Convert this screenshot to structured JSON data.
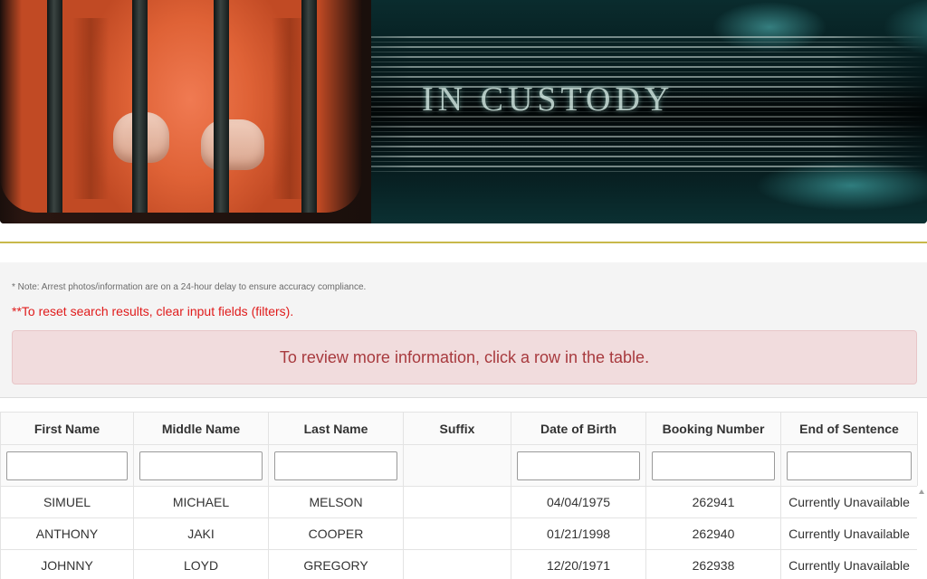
{
  "banner": {
    "title": "IN CUSTODY"
  },
  "notes": {
    "delay_note": "* Note: Arrest photos/information are on a 24-hour delay to ensure accuracy compliance.",
    "reset_note": "**To reset search results, clear input fields (filters).",
    "alert": "To review more information, click a row in the table."
  },
  "table": {
    "columns": [
      "First Name",
      "Middle Name",
      "Last Name",
      "Suffix",
      "Date of Birth",
      "Booking Number",
      "End of Sentence"
    ],
    "rows": [
      [
        "SIMUEL",
        "MICHAEL",
        "MELSON",
        "",
        "04/04/1975",
        "262941",
        "Currently Unavailable"
      ],
      [
        "ANTHONY",
        "JAKI",
        "COOPER",
        "",
        "01/21/1998",
        "262940",
        "Currently Unavailable"
      ],
      [
        "JOHNNY",
        "LOYD",
        "GREGORY",
        "",
        "12/20/1971",
        "262938",
        "Currently Unavailable"
      ]
    ]
  },
  "colors": {
    "alert_bg": "#f1dcdd",
    "alert_text": "#a83a3e",
    "reset_note": "#e01b1b",
    "gold_rule": "#c8b84a"
  }
}
